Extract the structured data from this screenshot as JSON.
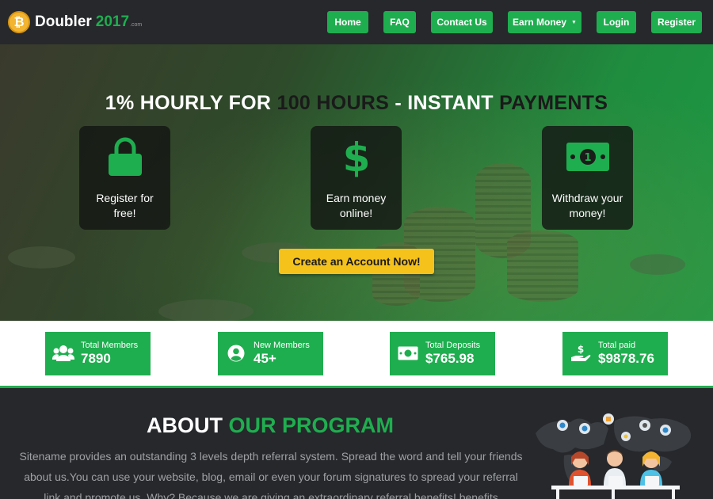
{
  "logo": {
    "coin_glyph": "₿",
    "name": "Doubler",
    "year": "2017",
    "suffix": ".com"
  },
  "nav": {
    "home": "Home",
    "faq": "FAQ",
    "contact": "Contact Us",
    "earn": "Earn Money",
    "login": "Login",
    "register": "Register"
  },
  "hero": {
    "title_part1": "1% HOURLY FOR ",
    "title_part2": "100 HOURS",
    "title_part3": " - INSTANT ",
    "title_part4": "PAYMENTS",
    "features": [
      {
        "icon": "lock-icon",
        "line1": "Register for",
        "line2": "free!"
      },
      {
        "icon": "dollar-icon",
        "line1": "Earn money",
        "line2": "online!"
      },
      {
        "icon": "money-bill-icon",
        "line1": "Withdraw your",
        "line2": "money!"
      }
    ],
    "cta": "Create an Account Now!"
  },
  "stats": [
    {
      "icon": "users-icon",
      "label": "Total Members",
      "value": "7890"
    },
    {
      "icon": "user-circle-icon",
      "label": "New Members",
      "value": "45+"
    },
    {
      "icon": "money-bill-icon",
      "label": "Total Deposits",
      "value": "$765.98"
    },
    {
      "icon": "hand-dollar-icon",
      "label": "Total paid",
      "value": "$9878.76"
    }
  ],
  "about": {
    "title_part1": "ABOUT ",
    "title_part2": "OUR PROGRAM",
    "text": "Sitename provides an outstanding 3 levels depth referral system. Spread the word and tell your friends about us.You can use your website, blog, email or even your forum signatures to spread your referral link and promote us. Why? Because we are giving an extraordinary referral benefits! benefits"
  },
  "colors": {
    "green": "#1fae4f",
    "yellow": "#f5c21b",
    "dark": "#26282c",
    "gold": "#f2b431"
  }
}
